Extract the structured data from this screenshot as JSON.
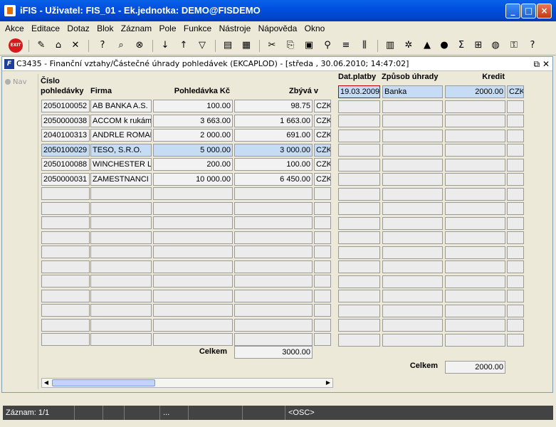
{
  "window": {
    "title": "iFIS - Uživatel: FIS_01 - Ek.jednotka: DEMO@FISDEMO",
    "buttons": [
      "_",
      "□",
      "×"
    ]
  },
  "menu": [
    "Akce",
    "Editace",
    "Dotaz",
    "Blok",
    "Záznam",
    "Pole",
    "Funkce",
    "Nástroje",
    "Nápověda",
    "Okno"
  ],
  "toolbar": {
    "exit_label": "EXIT",
    "icons": [
      "exit-icon",
      "edit-icon",
      "save-icon",
      "delete-icon",
      "query-icon",
      "execute-query-icon",
      "cancel-query-icon",
      "sort-asc-icon",
      "sort-desc-icon",
      "filter-icon",
      "print-icon",
      "print-preview-icon",
      "cut-icon",
      "copy-icon",
      "paste-icon",
      "search-icon",
      "align-icon",
      "columns-icon",
      "calc-icon",
      "tools-icon",
      "up-icon",
      "record-icon",
      "sum-icon",
      "excel-icon",
      "globe-icon",
      "key-icon",
      "help-icon"
    ],
    "sum_glyph": "Σ",
    "help_glyph": "?"
  },
  "form": {
    "title": "C3435 - Finanční vztahy/Částečné úhrady pohledávek (EKCAPLOD) - [středa , 30.06.2010; 14:47:02]",
    "icon_text": "F",
    "nav_label": "Nav"
  },
  "left_table": {
    "headers": {
      "cislo_line1": "Číslo",
      "cislo_line2": "pohledávky",
      "firma": "Firma",
      "pohledavka": "Pohledávka Kč",
      "zbyva": "Zbývá v"
    },
    "rows": [
      {
        "cislo": "2050100052",
        "firma": "AB BANKA A.S.",
        "pohledavka": "100.00",
        "zbyva": "98.75",
        "mena": "CZK"
      },
      {
        "cislo": "2050000038",
        "firma": "ACCOM k rukám M",
        "pohledavka": "3 663.00",
        "zbyva": "1 663.00",
        "mena": "CZK"
      },
      {
        "cislo": "2040100313",
        "firma": "ANDRLE ROMAN",
        "pohledavka": "2 000.00",
        "zbyva": "691.00",
        "mena": "CZK"
      },
      {
        "cislo": "2050100029",
        "firma": "TESO, S.R.O.",
        "pohledavka": "5 000.00",
        "zbyva": "3 000.00",
        "mena": "CZK"
      },
      {
        "cislo": "2050100088",
        "firma": "WINCHESTER Leo",
        "pohledavka": "200.00",
        "zbyva": "100.00",
        "mena": "CZK"
      },
      {
        "cislo": "2050000031",
        "firma": "ZAMESTNANCI",
        "pohledavka": "10 000.00",
        "zbyva": "6 450.00",
        "mena": "CZK"
      }
    ],
    "total_label": "Celkem",
    "total_value": "3000.00"
  },
  "right_table": {
    "headers": {
      "datum": "Dat.platby",
      "zpusob": "Způsob úhrady",
      "kredit": "Kredit"
    },
    "rows": [
      {
        "datum": "19.03.2009",
        "zpusob": "Banka",
        "kredit": "2000.00",
        "mena": "CZK"
      }
    ],
    "total_label": "Celkem",
    "total_value": "2000.00"
  },
  "statusbar": {
    "record": "Záznam: 1/1",
    "ellipsis": "...",
    "mode": "<OSC>"
  }
}
